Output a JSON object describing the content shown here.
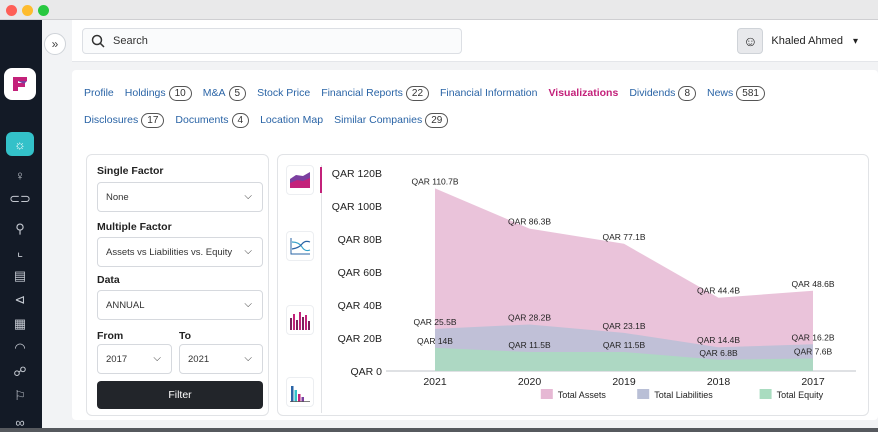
{
  "window": {
    "dots": [
      "#fe5f57",
      "#febc2e",
      "#28c840"
    ]
  },
  "search": {
    "placeholder": "Search"
  },
  "user": {
    "name": "Khaled Ahmed"
  },
  "tabs": [
    {
      "label": "Profile",
      "badge": null
    },
    {
      "label": "Holdings",
      "badge": "10"
    },
    {
      "label": "M&A",
      "badge": "5"
    },
    {
      "label": "Stock Price",
      "badge": null
    },
    {
      "label": "Financial Reports",
      "badge": "22"
    },
    {
      "label": "Financial Information",
      "badge": null
    },
    {
      "label": "Visualizations",
      "badge": null
    },
    {
      "label": "Dividends",
      "badge": "8"
    },
    {
      "label": "News",
      "badge": "581"
    },
    {
      "label": "Disclosures",
      "badge": "17"
    },
    {
      "label": "Documents",
      "badge": "4"
    },
    {
      "label": "Location Map",
      "badge": null
    },
    {
      "label": "Similar Companies",
      "badge": "29"
    }
  ],
  "active_tab": "Visualizations",
  "filters": {
    "single_factor_label": "Single Factor",
    "single_factor_value": "None",
    "multiple_factor_label": "Multiple Factor",
    "multiple_factor_value": "Assets vs Liabilities vs. Equity",
    "data_label": "Data",
    "data_value": "ANNUAL",
    "from_label": "From",
    "from_value": "2017",
    "to_label": "To",
    "to_value": "2021",
    "button": "Filter"
  },
  "chart_data": {
    "type": "area",
    "categories": [
      "2021",
      "2020",
      "2019",
      "2018",
      "2017"
    ],
    "y_ticks": [
      "QAR 0",
      "QAR 20B",
      "QAR 40B",
      "QAR 60B",
      "QAR 80B",
      "QAR 100B",
      "QAR 120B"
    ],
    "ylim": [
      0,
      120
    ],
    "grid": false,
    "legend_position": "bottom-right",
    "series": [
      {
        "name": "Total Assets",
        "values": [
          110.7,
          86.3,
          77.1,
          44.4,
          48.6
        ],
        "labels": [
          "QAR 110.7B",
          "QAR 86.3B",
          "QAR 77.1B",
          "QAR 44.4B",
          "QAR 48.6B"
        ],
        "color": "#e6b8d4"
      },
      {
        "name": "Total Liabilities",
        "values": [
          25.5,
          28.2,
          23.1,
          14.4,
          16.2
        ],
        "labels": [
          "QAR 25.5B",
          "QAR 28.2B",
          "QAR 23.1B",
          "QAR 14.4B",
          "QAR 16.2B"
        ],
        "color": "#b9bfd6"
      },
      {
        "name": "Total Equity",
        "values": [
          14,
          11.5,
          11.5,
          6.8,
          7.6
        ],
        "labels": [
          "QAR 14B",
          "QAR 11.5B",
          "QAR 11.5B",
          "QAR 6.8B",
          "QAR 7.6B"
        ],
        "color": "#a9dcc0"
      }
    ]
  }
}
